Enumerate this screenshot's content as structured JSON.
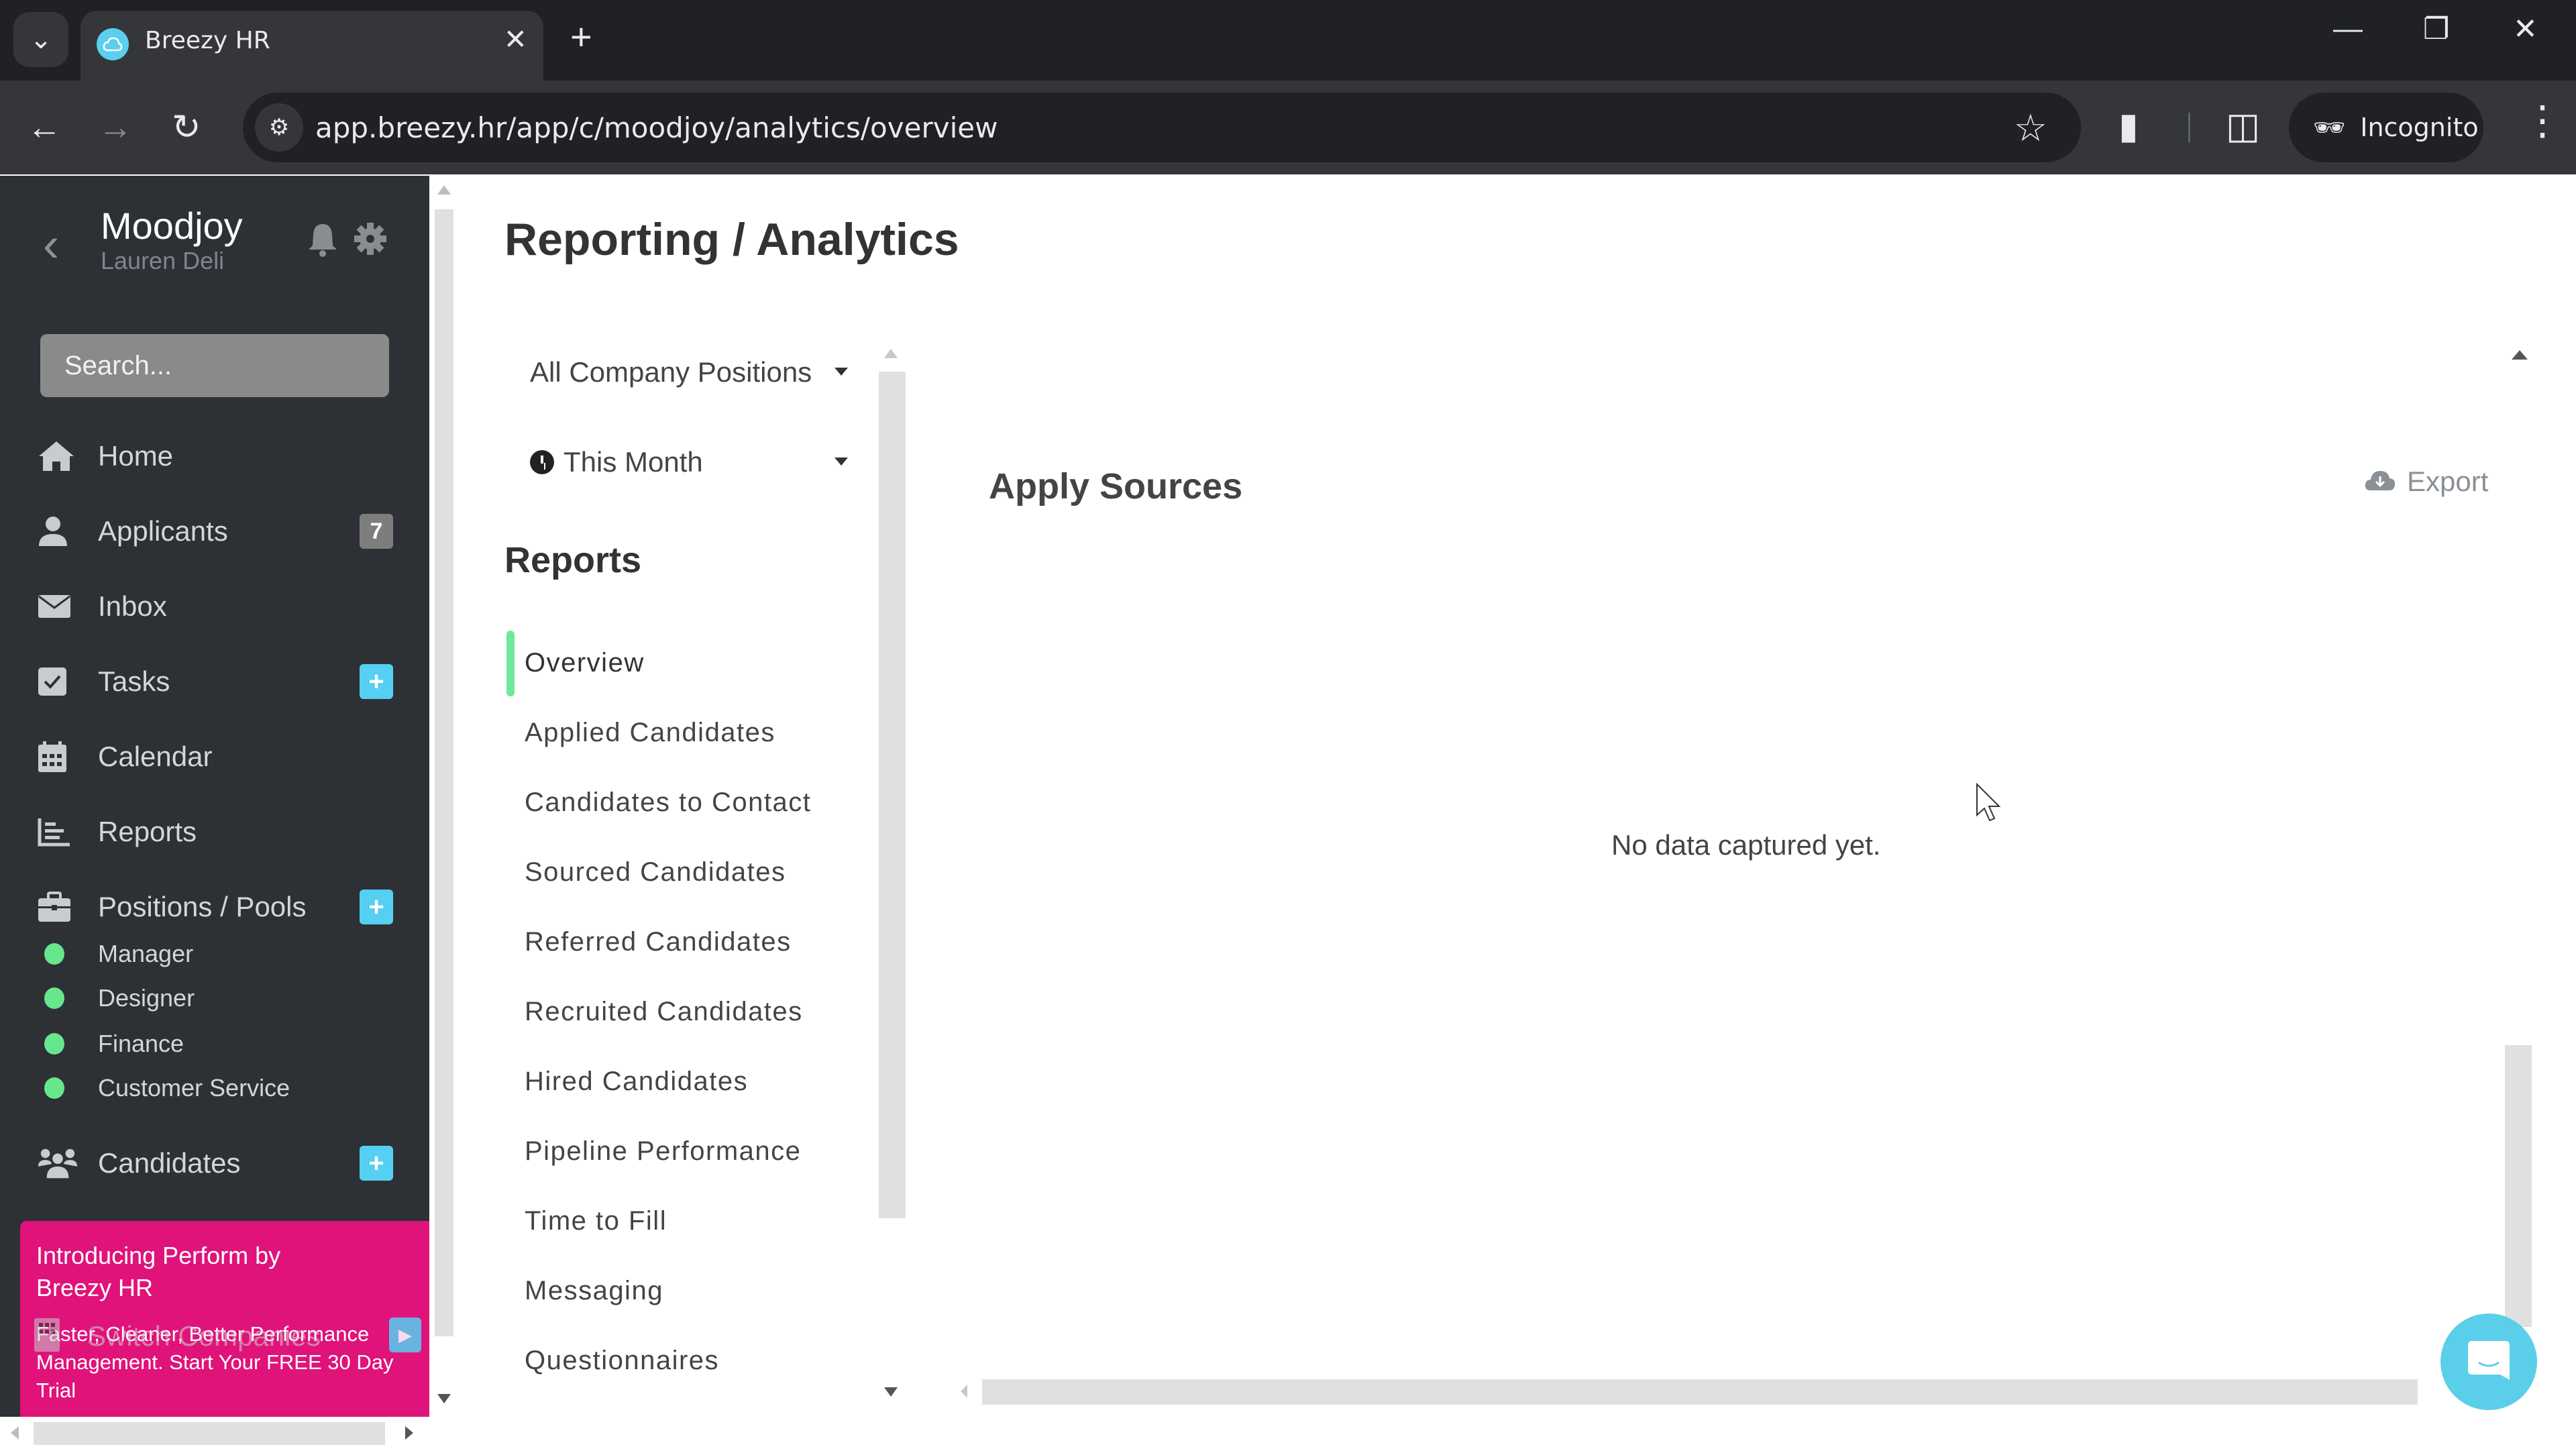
{
  "browser": {
    "tab_title": "Breezy HR",
    "url": "app.breezy.hr/app/c/moodjoy/analytics/overview",
    "incognito_label": "Incognito",
    "accent": "#5bcff0"
  },
  "sidebar": {
    "company": "Moodjoy",
    "user": "Lauren Deli",
    "search_placeholder": "Search...",
    "items": [
      {
        "label": "Home",
        "icon": "home-icon"
      },
      {
        "label": "Applicants",
        "icon": "user-icon",
        "badge": "7"
      },
      {
        "label": "Inbox",
        "icon": "envelope-icon"
      },
      {
        "label": "Tasks",
        "icon": "checkbox-icon",
        "badge": "+"
      },
      {
        "label": "Calendar",
        "icon": "calendar-icon"
      },
      {
        "label": "Reports",
        "icon": "bar-chart-icon"
      },
      {
        "label": "Positions / Pools",
        "icon": "briefcase-icon",
        "badge": "+"
      },
      {
        "label": "Candidates",
        "icon": "users-icon",
        "badge": "+"
      }
    ],
    "positions": [
      {
        "label": "Manager",
        "status_color": "#68e68e"
      },
      {
        "label": "Designer",
        "status_color": "#68e68e"
      },
      {
        "label": "Finance",
        "status_color": "#68e68e"
      },
      {
        "label": "Customer Service",
        "status_color": "#68e68e"
      }
    ],
    "switch_companies": "Switch Companies",
    "promo": {
      "heading": "Introducing Perform by Breezy HR",
      "body": "Faster, Cleaner, Better Performance Management. Start Your FREE 30 Day Trial",
      "color": "#e0137a"
    }
  },
  "main": {
    "title": "Reporting / Analytics",
    "filters": {
      "positions": "All Company Positions",
      "period": "This Month"
    },
    "reports_heading": "Reports",
    "reports": [
      "Overview",
      "Applied Candidates",
      "Candidates to Contact",
      "Sourced Candidates",
      "Referred Candidates",
      "Recruited Candidates",
      "Hired Candidates",
      "Pipeline Performance",
      "Time to Fill",
      "Messaging",
      "Questionnaires"
    ],
    "active_report": "Overview",
    "panel": {
      "title": "Apply Sources",
      "export_label": "Export",
      "empty_message": "No data captured yet."
    }
  }
}
